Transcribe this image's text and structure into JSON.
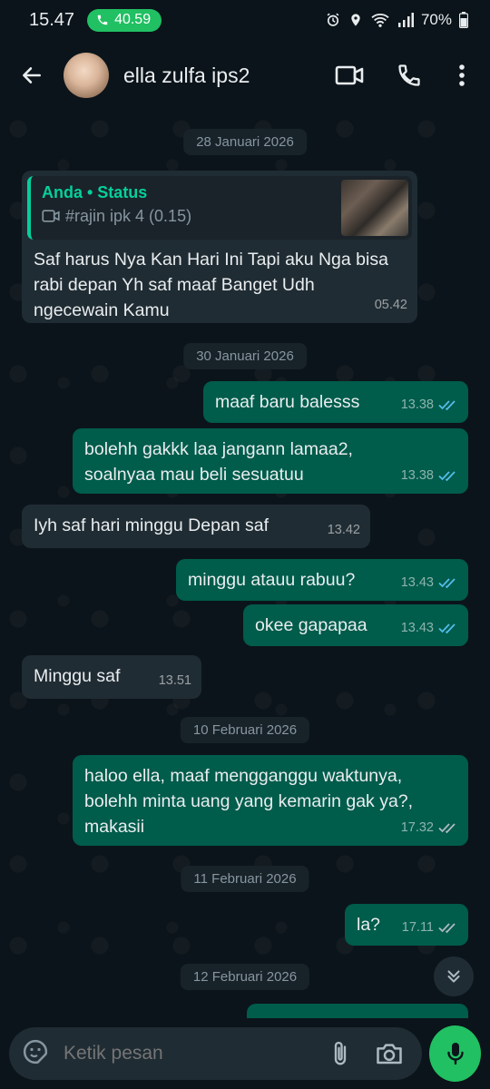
{
  "status_bar": {
    "time": "15.47",
    "call_duration": "40.59",
    "battery": "70%"
  },
  "header": {
    "contact_name": "ella zulfa ips2",
    "icons": [
      "back-arrow-icon",
      "video-call-icon",
      "voice-call-icon",
      "more-vert-icon"
    ]
  },
  "chat": {
    "dates": {
      "d1": "28 Januari 2026",
      "d2": "30 Januari 2026",
      "d3": "10 Februari 2026",
      "d4": "11 Februari 2026",
      "d5": "12 Februari 2026"
    },
    "quoted": {
      "author": "Anda • Status",
      "text": "#rajin ipk 4 (0.15)"
    },
    "messages": [
      {
        "dir": "in",
        "text": "Saf harus Nya Kan Hari Ini Tapi aku Nga bisa rabi depan Yh saf maaf Banget Udh ngecewain Kamu",
        "time": "05.42"
      },
      {
        "dir": "out",
        "text": "maaf baru balesss",
        "time": "13.38",
        "read": true
      },
      {
        "dir": "out",
        "text": "bolehh gakkk laa jangann lamaa2, soalnyaa mau beli sesuatuu",
        "time": "13.38",
        "read": true
      },
      {
        "dir": "in",
        "text": "Iyh saf hari minggu Depan saf",
        "time": "13.42"
      },
      {
        "dir": "out",
        "text": "minggu atauu rabuu?",
        "time": "13.43",
        "read": true
      },
      {
        "dir": "out",
        "text": "okee gapapaa",
        "time": "13.43",
        "read": true
      },
      {
        "dir": "in",
        "text": "Minggu saf",
        "time": "13.51"
      },
      {
        "dir": "out",
        "text": "haloo ella, maaf mengganggu waktunya, bolehh minta uang yang kemarin gak ya?, makasii",
        "time": "17.32",
        "read": false
      },
      {
        "dir": "out",
        "text": "la?",
        "time": "17.11",
        "read": false
      }
    ]
  },
  "input": {
    "placeholder": "Ketik pesan"
  },
  "colors": {
    "background": "#0b141a",
    "incoming": "#202c33",
    "outgoing": "#005c4b",
    "accent": "#21c063",
    "read_ticks": "#53bdeb"
  }
}
